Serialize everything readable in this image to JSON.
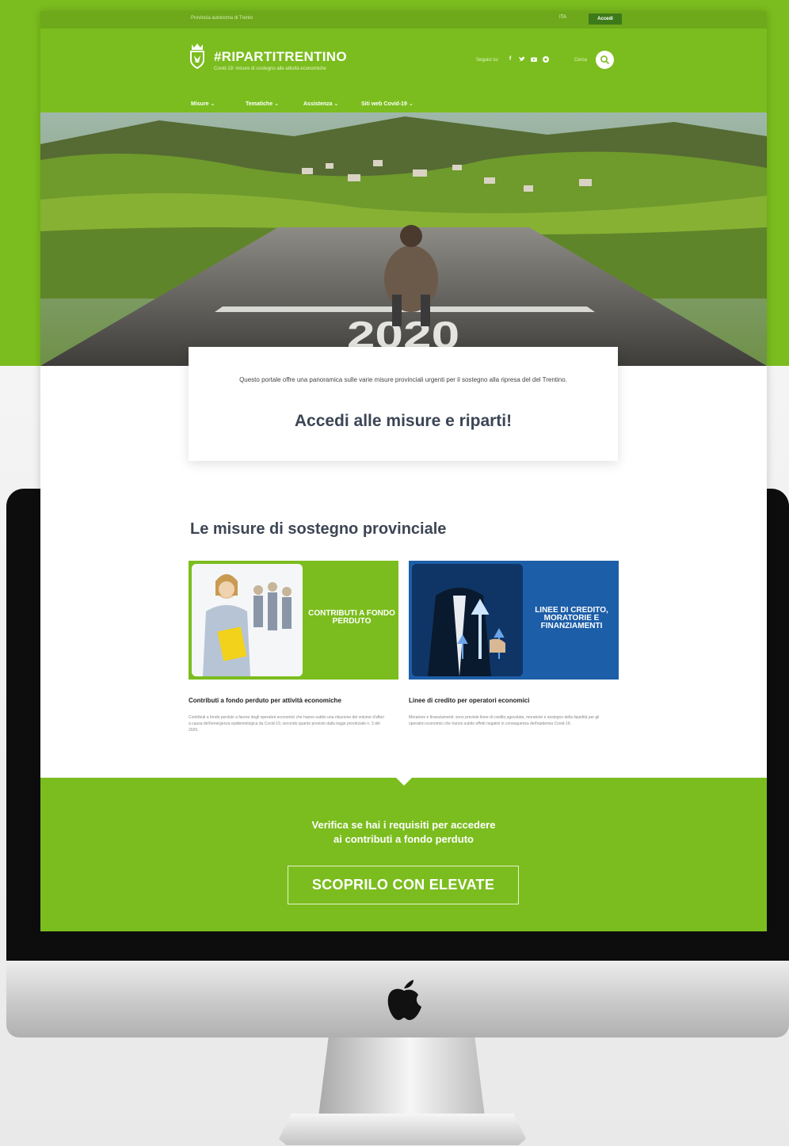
{
  "header": {
    "top_bar_text": "Provincia autonoma di Trento",
    "language": "ITA",
    "access_button": "Accedi",
    "site_title": "#RIPARTITRENTINO",
    "site_subtitle": "Covid-19: misure di sostegno alle attività economiche",
    "social_label": "Seguici su",
    "search_label": "Cerca"
  },
  "nav": [
    {
      "label": "Misure"
    },
    {
      "label": "Tematiche"
    },
    {
      "label": "Assistenza"
    },
    {
      "label": "Siti web Covid-19"
    }
  ],
  "hero": {
    "road_text": "2020"
  },
  "intro": {
    "text": "Questo portale offre una panoramica sulle varie misure provinciali urgenti per il sostegno alla ripresa del del Trentino.",
    "heading": "Accedi alle misure e riparti!"
  },
  "section": {
    "title": "Le misure di sostegno provinciale"
  },
  "cards": [
    {
      "image_label": "CONTRIBUTI A FONDO PERDUTO",
      "title": "Contributi a fondo perduto per attività economiche",
      "description": "Contributi a fondo perduto a favore degli operatori economici che hanno subito una riduzione del volume d'affari a causa dell'emergenza epidemiologica da Covid-19, secondo quanto previsto dalla legge provinciale n. 3 del 2020."
    },
    {
      "image_label": "LINEE DI CREDITO, MORATORIE E FINANZIAMENTI",
      "title": "Linee di credito per operatori economici",
      "description": "Moratorie e finanziamenti: sono previste linee di credito agevolate, moratorie e sostegno della liquidità per gli operatori economici che hanno subito effetti negativi in conseguenza dell'epidemia Covid-19."
    }
  ],
  "cta": {
    "line1": "Verifica se hai i requisiti per accedere",
    "line2": "ai contributi a fondo perduto",
    "button": "SCOPRILO CON ELEVATE"
  },
  "colors": {
    "brand_green": "#7bbd1e",
    "dark_green": "#3d7a1a",
    "card_blue": "#1d5ea8",
    "heading_slate": "#3b4554"
  },
  "icons": [
    "crest-icon",
    "facebook-icon",
    "twitter-icon",
    "youtube-icon",
    "instagram-icon",
    "search-icon",
    "chevron-down-icon",
    "apple-logo-icon"
  ]
}
